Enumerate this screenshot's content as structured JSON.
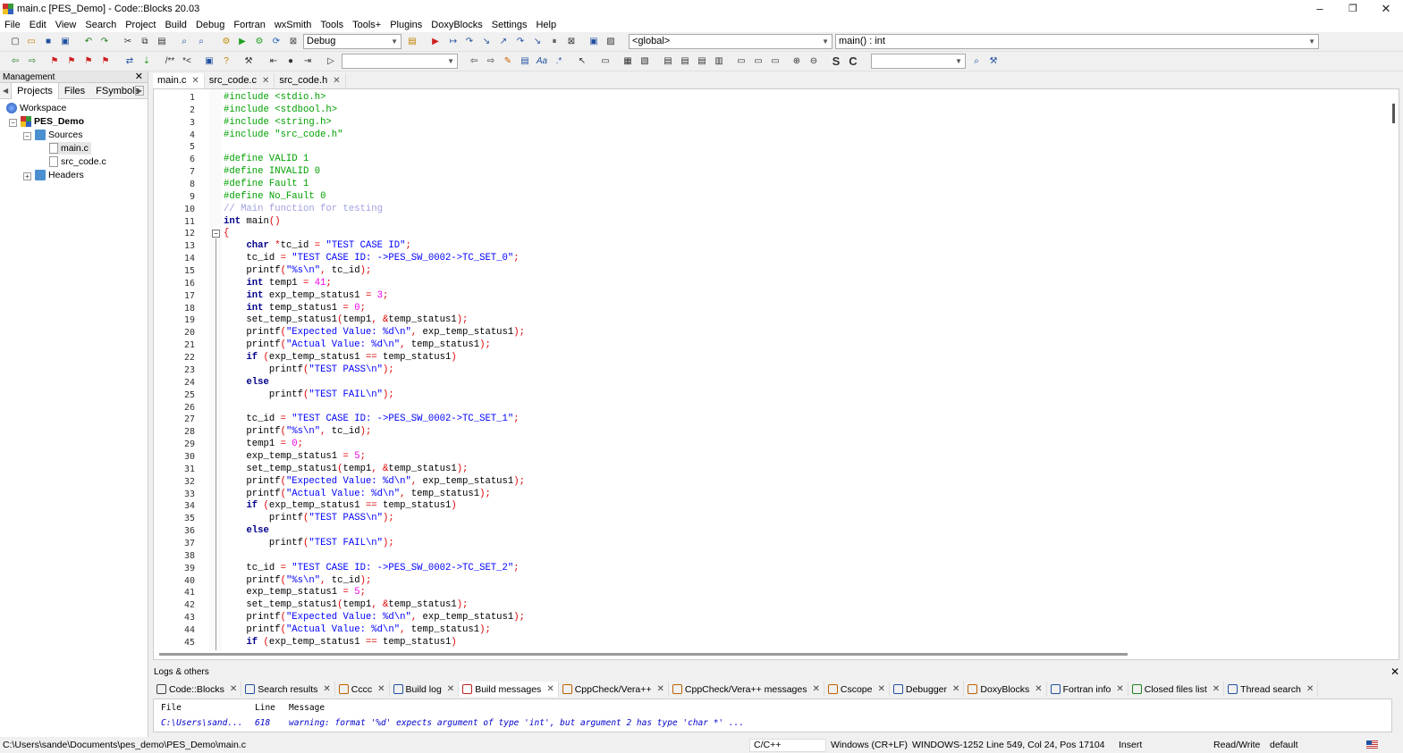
{
  "window": {
    "title": "main.c [PES_Demo] - Code::Blocks 20.03",
    "minimize": "–",
    "maximize": "❐",
    "close": "✕"
  },
  "menu": [
    "File",
    "Edit",
    "View",
    "Search",
    "Project",
    "Build",
    "Debug",
    "Fortran",
    "wxSmith",
    "Tools",
    "Tools+",
    "Plugins",
    "DoxyBlocks",
    "Settings",
    "Help"
  ],
  "toolbar": {
    "build_target": "Debug",
    "scope": "<global>",
    "function": "main() : int",
    "search_value": "",
    "search2_value": ""
  },
  "management": {
    "title": "Management",
    "tabs": [
      "Projects",
      "Files",
      "FSymbols"
    ],
    "tree": {
      "workspace": "Workspace",
      "project": "PES_Demo",
      "sources": "Sources",
      "file1": "main.c",
      "file2": "src_code.c",
      "headers": "Headers"
    }
  },
  "editor": {
    "tabs": [
      "main.c",
      "src_code.c",
      "src_code.h"
    ],
    "line_numbers": [
      "1",
      "2",
      "3",
      "4",
      "5",
      "6",
      "7",
      "8",
      "9",
      "10",
      "11",
      "12",
      "13",
      "14",
      "15",
      "16",
      "17",
      "18",
      "19",
      "20",
      "21",
      "22",
      "23",
      "24",
      "25",
      "26",
      "27",
      "28",
      "29",
      "30",
      "31",
      "32",
      "33",
      "34",
      "35",
      "36",
      "37",
      "38",
      "39",
      "40",
      "41",
      "42",
      "43",
      "44",
      "45"
    ],
    "lines": [
      "#include <stdio.h>",
      "#include <stdbool.h>",
      "#include <string.h>",
      "#include \"src_code.h\"",
      "",
      "#define VALID 1",
      "#define INVALID 0",
      "#define Fault 1",
      "#define No_Fault 0",
      "// Main function for testing",
      "int main()",
      "{",
      "    char *tc_id = \"TEST CASE ID\";",
      "    tc_id = \"TEST CASE ID: ->PES_SW_0002->TC_SET_0\";",
      "    printf(\"%s\\n\", tc_id);",
      "    int temp1 = 41;",
      "    int exp_temp_status1 = 3;",
      "    int temp_status1 = 0;",
      "    set_temp_status1(temp1, &temp_status1);",
      "    printf(\"Expected Value: %d\\n\", exp_temp_status1);",
      "    printf(\"Actual Value: %d\\n\", temp_status1);",
      "    if (exp_temp_status1 == temp_status1)",
      "        printf(\"TEST PASS\\n\");",
      "    else",
      "        printf(\"TEST FAIL\\n\");",
      "",
      "    tc_id = \"TEST CASE ID: ->PES_SW_0002->TC_SET_1\";",
      "    printf(\"%s\\n\", tc_id);",
      "    temp1 = 0;",
      "    exp_temp_status1 = 5;",
      "    set_temp_status1(temp1, &temp_status1);",
      "    printf(\"Expected Value: %d\\n\", exp_temp_status1);",
      "    printf(\"Actual Value: %d\\n\", temp_status1);",
      "    if (exp_temp_status1 == temp_status1)",
      "        printf(\"TEST PASS\\n\");",
      "    else",
      "        printf(\"TEST FAIL\\n\");",
      "",
      "    tc_id = \"TEST CASE ID: ->PES_SW_0002->TC_SET_2\";",
      "    printf(\"%s\\n\", tc_id);",
      "    exp_temp_status1 = 5;",
      "    set_temp_status1(temp1, &temp_status1);",
      "    printf(\"Expected Value: %d\\n\", exp_temp_status1);",
      "    printf(\"Actual Value: %d\\n\", temp_status1);",
      "    if (exp_temp_status1 == temp_status1)"
    ]
  },
  "logs": {
    "title": "Logs & others",
    "tabs": [
      "Code::Blocks",
      "Search results",
      "Cccc",
      "Build log",
      "Build messages",
      "CppCheck/Vera++",
      "CppCheck/Vera++ messages",
      "Cscope",
      "Debugger",
      "DoxyBlocks",
      "Fortran info",
      "Closed files list",
      "Thread search"
    ],
    "columns": [
      "File",
      "Line",
      "Message"
    ],
    "row": {
      "file": "C:\\Users\\sand...",
      "line": "618",
      "message": "warning: format '%d' expects argument of type 'int', but argument 2 has type 'char *' ..."
    }
  },
  "status": {
    "path": "C:\\Users\\sande\\Documents\\pes_demo\\PES_Demo\\main.c",
    "lang": "C/C++",
    "eol": "Windows (CR+LF)",
    "encoding": "WINDOWS-1252",
    "position": "Line 549, Col 24, Pos 17104",
    "mode": "Insert",
    "access": "Read/Write",
    "profile": "default"
  },
  "colors": {
    "preprocessor": "#00a000",
    "keyword": "#00008b",
    "string": "#0000ff",
    "comment": "#a0a0e0",
    "number": "#f000f0"
  }
}
